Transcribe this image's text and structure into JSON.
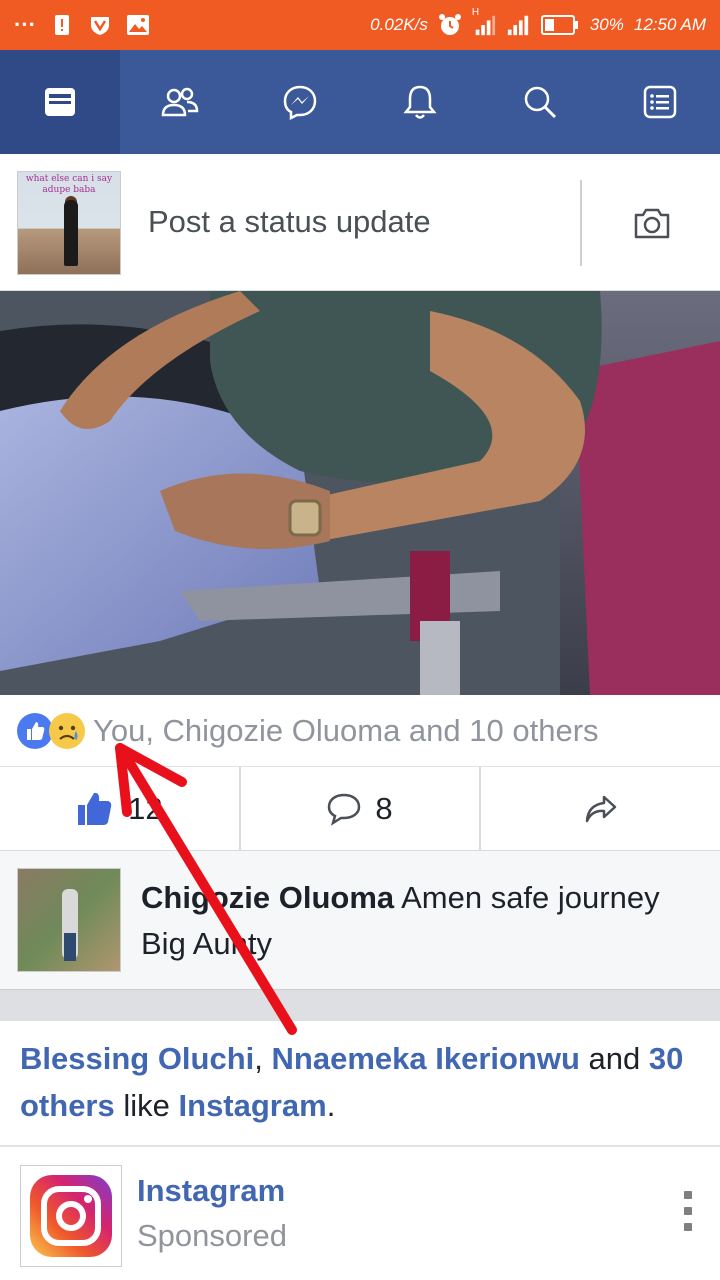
{
  "status_bar": {
    "dots": "···",
    "speed": "0.02K/s",
    "signal_h": "H",
    "battery": "30%",
    "time": "12:50 AM"
  },
  "nav": {
    "items": [
      {
        "name": "news-feed",
        "icon": "news-feed-icon",
        "active": true
      },
      {
        "name": "friends",
        "icon": "friends-icon"
      },
      {
        "name": "messenger",
        "icon": "messenger-icon"
      },
      {
        "name": "notifications",
        "icon": "bell-icon"
      },
      {
        "name": "search",
        "icon": "search-icon"
      },
      {
        "name": "menu",
        "icon": "menu-icon"
      }
    ]
  },
  "composer": {
    "avatar_caption": "what else can i say adupe baba",
    "placeholder": "Post a status update",
    "camera_icon": "camera-icon"
  },
  "post": {
    "reactions_text": "You, Chigozie Oluoma and 10 others",
    "like_count": "12",
    "comment_count": "8"
  },
  "comment": {
    "author": "Chigozie Oluoma",
    "text": "Amen safe journey Big  Aunty"
  },
  "ad": {
    "friend_1": "Blessing Oluchi",
    "friend_2": "Nnaemeka Ikerionwu",
    "and": "and",
    "others": "30 others",
    "like": "like",
    "page": "Instagram",
    "name": "Instagram",
    "sponsored": "Sponsored"
  },
  "colors": {
    "status_bar": "#f05a23",
    "nav_bar": "#3b5998",
    "link": "#4267b2",
    "annotation": "#e8111b"
  }
}
